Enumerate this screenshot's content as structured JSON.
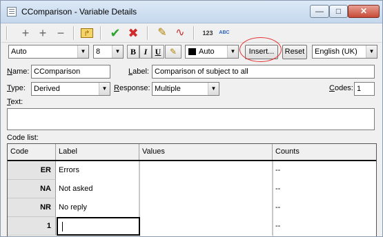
{
  "window": {
    "title": "CComparison - Variable Details",
    "min_glyph": "—",
    "max_glyph": "□",
    "close_glyph": "✕"
  },
  "toolbar": {
    "icons": [
      "add-icon",
      "add-multiple-icon",
      "remove-icon",
      "move-up-icon",
      "ok-icon",
      "cancel-icon",
      "edit-icon",
      "clear-icon",
      "numbering-icon",
      "spellcheck-icon"
    ],
    "glyphs": {
      "add": "+",
      "add_multi": "+",
      "remove": "−",
      "move_up": "↱",
      "ok": "✔",
      "cancel": "✖",
      "edit": "✎",
      "clear": "∿",
      "numbering": "123",
      "spell": "ABC"
    }
  },
  "format_bar": {
    "font_value": "Auto",
    "size_value": "8",
    "bold": "B",
    "italic": "I",
    "underline": "U",
    "highlight_glyph": "✎",
    "color_value": "Auto",
    "insert_label": "Insert...",
    "reset_label": "Reset",
    "language_value": "English (UK)",
    "arrow": "▼"
  },
  "form": {
    "name_label_u": "N",
    "name_label_rest": "ame:",
    "name_value": "CComparison",
    "label_label_u": "L",
    "label_label_rest": "abel:",
    "label_value": "Comparison of subject to all",
    "type_label_u": "T",
    "type_label_rest": "ype:",
    "type_value": "Derived",
    "response_label_u": "R",
    "response_label_rest": "esponse:",
    "response_value": "Multiple",
    "codes_label_u": "C",
    "codes_label_rest": "odes:",
    "codes_value": "1",
    "text_label_u": "T",
    "text_label_rest": "ext:",
    "text_value": "",
    "code_list_label": "Code list:"
  },
  "grid": {
    "headers": [
      "Code",
      "Label",
      "Values",
      "Counts"
    ],
    "rows": [
      {
        "code": "ER",
        "label": "Errors",
        "values": "",
        "counts": "--"
      },
      {
        "code": "NA",
        "label": "Not asked",
        "values": "",
        "counts": "--"
      },
      {
        "code": "NR",
        "label": "No reply",
        "values": "",
        "counts": "--"
      },
      {
        "code": "1",
        "label": "",
        "values": "",
        "counts": "--"
      }
    ]
  },
  "colors": {
    "highlight_ring": "#e53030",
    "ok_green": "#2ea42e",
    "cancel_red": "#d22a2a",
    "color_swatch": "#000000"
  }
}
